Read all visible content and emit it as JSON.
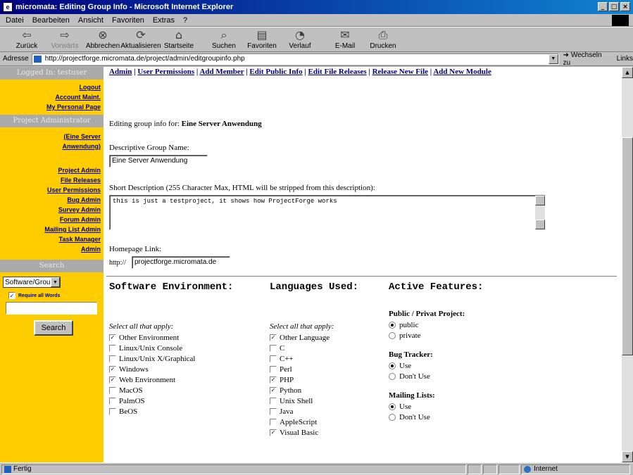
{
  "window": {
    "title": "micromata: Editing Group Info - Microsoft Internet Explorer"
  },
  "menu": [
    "Datei",
    "Bearbeiten",
    "Ansicht",
    "Favoriten",
    "Extras",
    "?"
  ],
  "toolbar": [
    {
      "label": "Zurück",
      "icon": "back-icon",
      "disabled": false
    },
    {
      "label": "Vorwärts",
      "icon": "forward-icon",
      "disabled": true
    },
    {
      "label": "Abbrechen",
      "icon": "stop-icon",
      "disabled": false
    },
    {
      "label": "Aktualisieren",
      "icon": "refresh-icon",
      "disabled": false
    },
    {
      "label": "Startseite",
      "icon": "home-icon",
      "disabled": false
    },
    {
      "label": "Suchen",
      "icon": "search-icon",
      "disabled": false
    },
    {
      "label": "Favoriten",
      "icon": "favorites-icon",
      "disabled": false
    },
    {
      "label": "Verlauf",
      "icon": "history-icon",
      "disabled": false
    },
    {
      "label": "E-Mail",
      "icon": "mail-icon",
      "disabled": false
    },
    {
      "label": "Drucken",
      "icon": "print-icon",
      "disabled": false
    }
  ],
  "address": {
    "label": "Adresse",
    "url": "http://projectforge.micromata.de/project/admin/editgroupinfo.php",
    "go_label": "Wechseln zu",
    "links_label": "Links"
  },
  "sidebar": {
    "logged_in_header": "Logged In: testuser",
    "account_links": [
      "Logout",
      "Account Maint.",
      "My Personal Page"
    ],
    "project_admin_header": "Project Administrator",
    "project_name": "(Eine Server Anwendung)",
    "admin_links": [
      "Project Admin",
      "File Releases",
      "User Permissions",
      "Bug Admin",
      "Survey Admin",
      "Forum Admin",
      "Mailing List Admin",
      "Task Manager Admin"
    ],
    "search_header": "Search",
    "search_select": "Software/Group",
    "search_web_label": "Require all Words",
    "search_button": "Search"
  },
  "main": {
    "nav_links": [
      "Admin",
      "User Permissions",
      "Add Member",
      "Edit Public Info",
      "Edit File Releases",
      "Release New File",
      "Add New Module"
    ],
    "editing_prefix": "Editing group info for:",
    "group_name": "Eine Server Anwendung",
    "descriptive_label": "Descriptive Group Name:",
    "descriptive_value": "Eine Server Anwendung",
    "short_desc_label": "Short Description (255 Character Max, HTML will be stripped from this description):",
    "short_desc_value": "this is just a testproject, it shows how ProjectForge works",
    "homepage_label": "Homepage Link:",
    "homepage_prefix": "http://",
    "homepage_value": "projectforge.micromata.de"
  },
  "sections": {
    "software_env": {
      "title": "Software Environment:",
      "hint": "Select all that apply:",
      "options": [
        {
          "label": "Other Environment",
          "checked": true
        },
        {
          "label": "Linux/Unix Console",
          "checked": false
        },
        {
          "label": "Linux/Unix X/Graphical",
          "checked": false
        },
        {
          "label": "Windows",
          "checked": true
        },
        {
          "label": "Web Environment",
          "checked": true
        },
        {
          "label": "MacOS",
          "checked": false
        },
        {
          "label": "PalmOS",
          "checked": false
        },
        {
          "label": "BeOS",
          "checked": false
        }
      ]
    },
    "languages": {
      "title": "Languages Used:",
      "hint": "Select all that apply:",
      "options": [
        {
          "label": "Other Language",
          "checked": true
        },
        {
          "label": "C",
          "checked": false
        },
        {
          "label": "C++",
          "checked": false
        },
        {
          "label": "Perl",
          "checked": false
        },
        {
          "label": "PHP",
          "checked": true
        },
        {
          "label": "Python",
          "checked": true
        },
        {
          "label": "Unix Shell",
          "checked": false
        },
        {
          "label": "Java",
          "checked": false
        },
        {
          "label": "AppleScript",
          "checked": false
        },
        {
          "label": "Visual Basic",
          "checked": true
        }
      ]
    },
    "features": {
      "title": "Active Features:",
      "groups": [
        {
          "title": "Public / Privat Project:",
          "options": [
            {
              "label": "public",
              "selected": true
            },
            {
              "label": "private",
              "selected": false
            }
          ]
        },
        {
          "title": "Bug Tracker:",
          "options": [
            {
              "label": "Use",
              "selected": true
            },
            {
              "label": "Don't Use",
              "selected": false
            }
          ]
        },
        {
          "title": "Mailing Lists:",
          "options": [
            {
              "label": "Use",
              "selected": true
            },
            {
              "label": "Don't Use",
              "selected": false
            }
          ]
        }
      ]
    }
  },
  "status": {
    "text": "Fertig",
    "zone": "Internet"
  }
}
